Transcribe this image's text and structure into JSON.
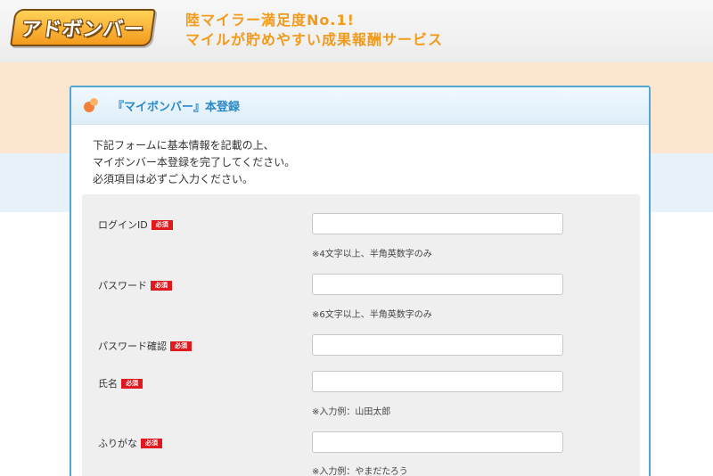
{
  "header": {
    "logo_text": "アドボンバー",
    "tagline_line1": "陸マイラー満足度No.1!",
    "tagline_line2": "マイルが貯めやすい成果報酬サービス"
  },
  "card": {
    "title": "『マイボンバー』本登録",
    "intro": [
      "下記フォームに基本情報を記載の上、",
      "マイボンバー本登録を完了してください。",
      "必須項目は必ずご入力ください。"
    ]
  },
  "form": {
    "required_badge": "必須",
    "fields": [
      {
        "label": "ログインID",
        "value": "",
        "hint": "※4文字以上、半角英数字のみ"
      },
      {
        "label": "パスワード",
        "value": "",
        "hint": "※6文字以上、半角英数字のみ"
      },
      {
        "label": "パスワード確認",
        "value": "",
        "hint": ""
      },
      {
        "label": "氏名",
        "value": "",
        "hint": "※入力例：山田太郎"
      },
      {
        "label": "ふりがな",
        "value": "",
        "hint": "※入力例：やまだたろう"
      }
    ]
  },
  "colors": {
    "accent": "#f29a1a",
    "title_blue": "#2b88c8",
    "card_border": "#4fa7d8",
    "required_red": "#e0191e"
  }
}
